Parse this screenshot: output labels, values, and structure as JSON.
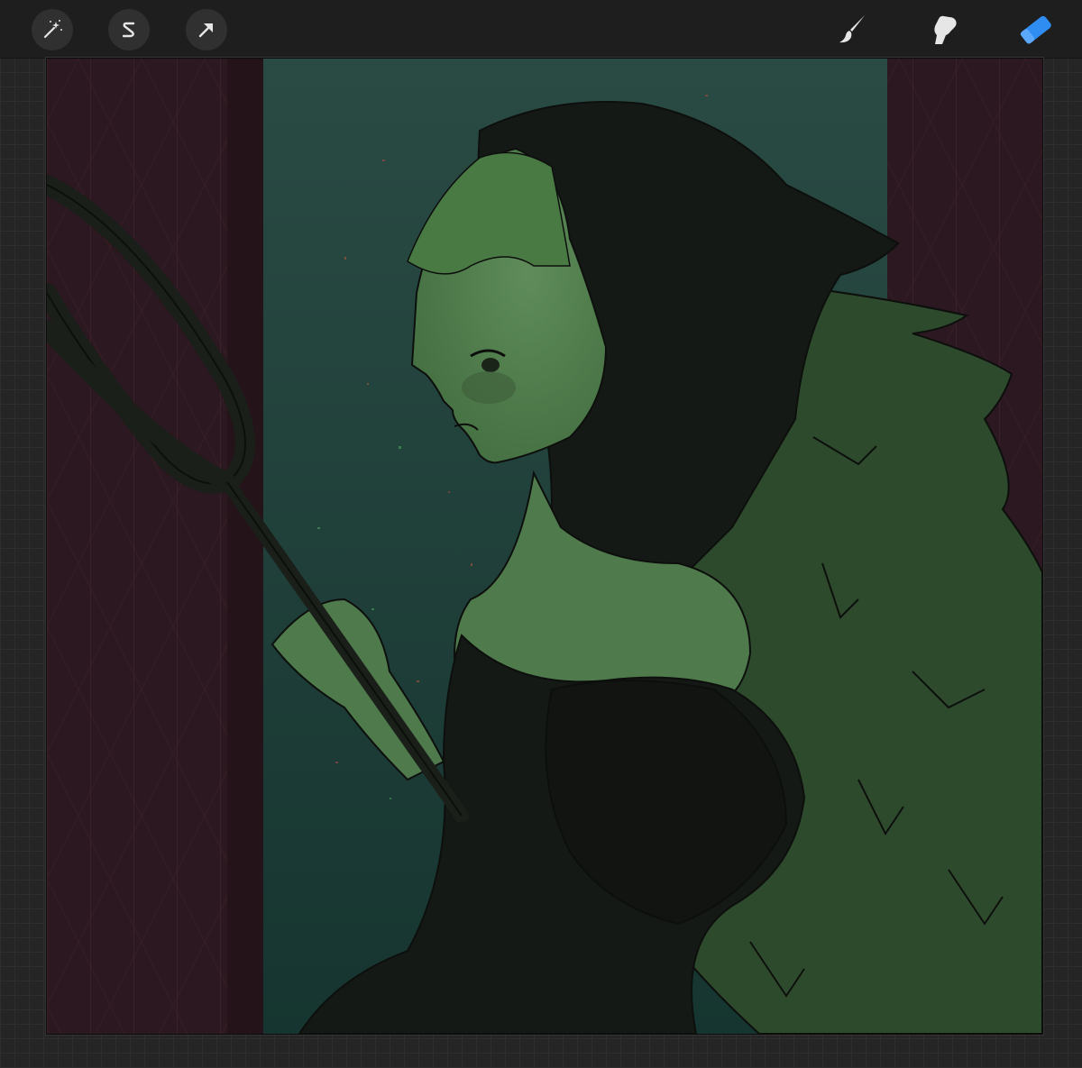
{
  "app": {
    "name": "drawing-canvas"
  },
  "toolbar": {
    "left_tools": [
      {
        "id": "adjustments",
        "icon": "magic-wand-icon"
      },
      {
        "id": "selection",
        "icon": "selection-s-icon"
      },
      {
        "id": "transform",
        "icon": "arrow-cursor-icon"
      }
    ],
    "right_tools": [
      {
        "id": "brush",
        "icon": "paintbrush-icon"
      },
      {
        "id": "smudge",
        "icon": "smudge-finger-icon"
      },
      {
        "id": "eraser",
        "icon": "eraser-icon",
        "active": true
      }
    ],
    "colors": {
      "bar": "#1e1e1e",
      "icon": "#e6e6e6",
      "active": "#2f8cf0"
    }
  },
  "canvas": {
    "colors": {
      "curtain": "#2b1820",
      "curtain_dark": "#24141a",
      "window": "#1f3b37",
      "skin": "#4f7a4c",
      "fur": "#2e4a2c",
      "dark": "#151915",
      "line": "#0d0f0d"
    }
  }
}
